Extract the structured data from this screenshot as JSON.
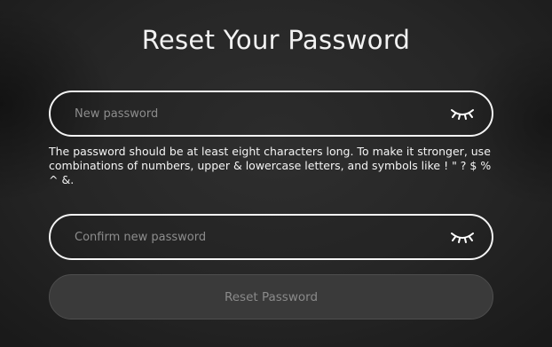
{
  "page": {
    "title": "Reset Your Password"
  },
  "new_password": {
    "placeholder": "New password",
    "value": "",
    "toggle_icon": "eye-closed-icon"
  },
  "hint": {
    "text": "The password should be at least eight characters long. To make it stronger, use combinations of numbers, upper & lowercase letters, and symbols like ! \" ? $ % ^ &."
  },
  "confirm_password": {
    "placeholder": "Confirm new password",
    "value": "",
    "toggle_icon": "eye-closed-icon"
  },
  "submit": {
    "label": "Reset Password",
    "disabled": true
  },
  "colors": {
    "background": "#2b2b2b",
    "field_border": "#f4f4f4",
    "text": "#f2f2f2",
    "placeholder": "#8d8d8d",
    "button_bg": "#3a3a3a",
    "button_text": "#8a8a8a"
  }
}
